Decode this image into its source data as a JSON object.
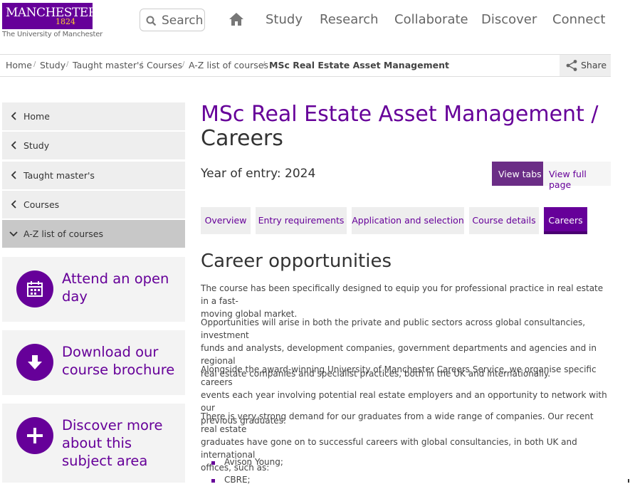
{
  "header": {
    "logo_name": "MANCHESTER",
    "logo_year": "1824",
    "logo_sub": "The University of Manchester",
    "search_label": "Search",
    "nav": [
      "Study",
      "Research",
      "Collaborate",
      "Discover",
      "Connect"
    ]
  },
  "breadcrumb": {
    "items": [
      "Home",
      "Study",
      "Taught master's",
      "Courses",
      "A-Z list of courses"
    ],
    "current": "MSc Real Estate Asset Management",
    "share_label": "Share"
  },
  "sidebar": {
    "items": [
      {
        "label": "Home"
      },
      {
        "label": "Study"
      },
      {
        "label": "Taught master's"
      },
      {
        "label": "Courses"
      },
      {
        "label": "A-Z list of courses"
      }
    ],
    "cards": [
      {
        "lines": [
          "Attend an open",
          "day"
        ],
        "icon": "calendar-icon"
      },
      {
        "lines": [
          "Download our",
          "course brochure"
        ],
        "icon": "download-arrow-icon"
      },
      {
        "lines": [
          "Discover more",
          "about this",
          "subject area"
        ],
        "icon": "plus-icon"
      }
    ]
  },
  "main": {
    "title": "MSc Real Estate Asset Management /",
    "title_sub": "Careers",
    "entry": "Year of entry: 2024",
    "view_tabs": "View tabs",
    "view_full": "View full page",
    "tabs": [
      "Overview",
      "Entry requirements",
      "Application and selection",
      "Course details",
      "Careers"
    ],
    "heading": "Career opportunities",
    "paragraphs": [
      [
        "The course has been specifically designed to equip you for professional practice in real estate in a fast-",
        "moving global market."
      ],
      [
        "Opportunities will arise in both the private and public sectors across global consultancies, investment",
        "funds and analysts, development companies, government departments and agencies and in regional",
        "real estate companies and specialist practices, both in the UK and internationally."
      ],
      [
        "Alongside the award-winning University of Manchester Careers Service, we organise specific careers",
        "events each year involving potential real estate employers and an opportunity to network with our",
        "previous graduates."
      ],
      [
        "There is very strong demand for our graduates from a wide range of companies. Our recent real estate",
        "graduates have gone on to successful careers with global consultancies, in both UK and international",
        "offices, such as:"
      ]
    ],
    "list": [
      "Avison Young;",
      "CBRE;"
    ]
  },
  "colors": {
    "brand": "#660099",
    "brand_dark": "#6b2d86",
    "logo_gold": "#ffcc33"
  }
}
